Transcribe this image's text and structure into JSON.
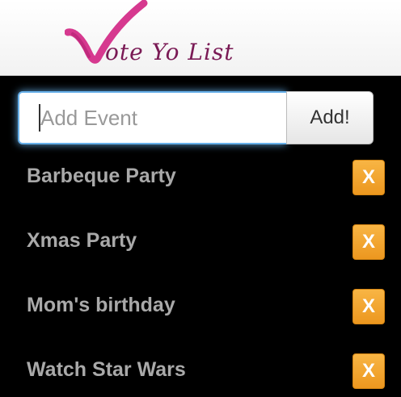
{
  "header": {
    "logo_text": "ote Yo List",
    "logo_mark": "checkmark-v-icon",
    "logo_colors": {
      "check": "#d6398f",
      "text": "#7a1a55"
    }
  },
  "form": {
    "input_placeholder": "Add Event",
    "input_value": "",
    "add_label": "Add!"
  },
  "events": [
    {
      "label": "Barbeque Party",
      "delete_label": "X"
    },
    {
      "label": "Xmas Party",
      "delete_label": "X"
    },
    {
      "label": "Mom's birthday",
      "delete_label": "X"
    },
    {
      "label": "Watch Star Wars",
      "delete_label": "X"
    }
  ],
  "colors": {
    "page_bg": "#000000",
    "event_text": "#a9a9a9",
    "delete_bg": "#f0ad4e",
    "input_focus": "#66afe9"
  }
}
